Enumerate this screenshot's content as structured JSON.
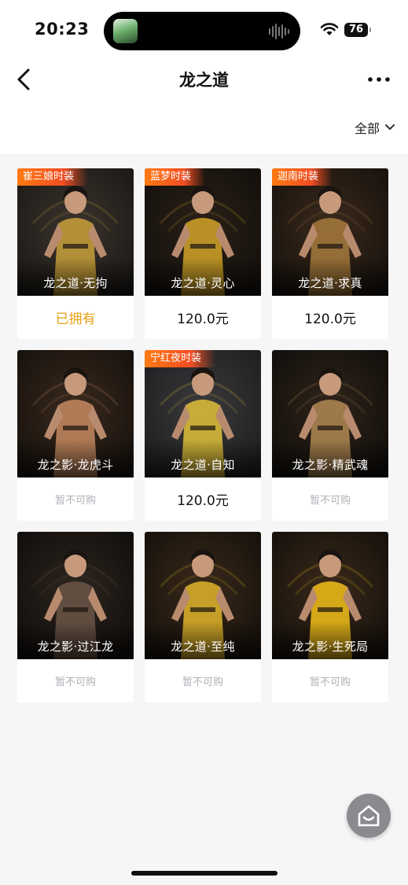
{
  "status_bar": {
    "time": "20:23",
    "battery": "76"
  },
  "header": {
    "title": "龙之道"
  },
  "filter": {
    "label": "全部"
  },
  "items": [
    {
      "name": "龙之道·无拘",
      "tag": "崔三娘时装",
      "status": "已拥有",
      "status_type": "owned",
      "palette": [
        "#3b342d",
        "#1a1714",
        "#c9a03a"
      ]
    },
    {
      "name": "龙之道·灵心",
      "tag": "蓝梦时装",
      "status": "120.0元",
      "status_type": "price",
      "palette": [
        "#2a2118",
        "#120e0b",
        "#d2a528"
      ]
    },
    {
      "name": "龙之道·求真",
      "tag": "迦南时装",
      "status": "120.0元",
      "status_type": "price",
      "palette": [
        "#3b2a1c",
        "#15100c",
        "#a77a3d"
      ]
    },
    {
      "name": "龙之影·龙虎斗",
      "tag": "",
      "status": "暂不可购",
      "status_type": "unavailable",
      "palette": [
        "#3a2a1e",
        "#140f0b",
        "#c58a62"
      ]
    },
    {
      "name": "龙之道·自知",
      "tag": "宁红夜时装",
      "status": "120.0元",
      "status_type": "price",
      "palette": [
        "#3a3a3c",
        "#1d1d1f",
        "#e2c13a"
      ]
    },
    {
      "name": "龙之影·精武魂",
      "tag": "",
      "status": "暂不可购",
      "status_type": "unavailable",
      "palette": [
        "#2f241a",
        "#100d0a",
        "#b18a54"
      ]
    },
    {
      "name": "龙之影·过江龙",
      "tag": "",
      "status": "暂不可购",
      "status_type": "unavailable",
      "palette": [
        "#2e2620",
        "#0f0c0a",
        "#6b5648"
      ]
    },
    {
      "name": "龙之道·至纯",
      "tag": "",
      "status": "暂不可购",
      "status_type": "unavailable",
      "palette": [
        "#3a2a1b",
        "#140f0a",
        "#e0b52c"
      ]
    },
    {
      "name": "龙之影·生死局",
      "tag": "",
      "status": "暂不可购",
      "status_type": "unavailable",
      "palette": [
        "#3a2a1b",
        "#140f0a",
        "#f2c019"
      ]
    }
  ],
  "colors": {
    "accent_owned": "#e6a117",
    "tag_start": "#ff7a12",
    "tag_end": "#f24d22"
  },
  "icons": [
    "back-icon",
    "more-icon",
    "chevron-down-icon",
    "wifi-icon",
    "battery-icon",
    "home-icon"
  ]
}
